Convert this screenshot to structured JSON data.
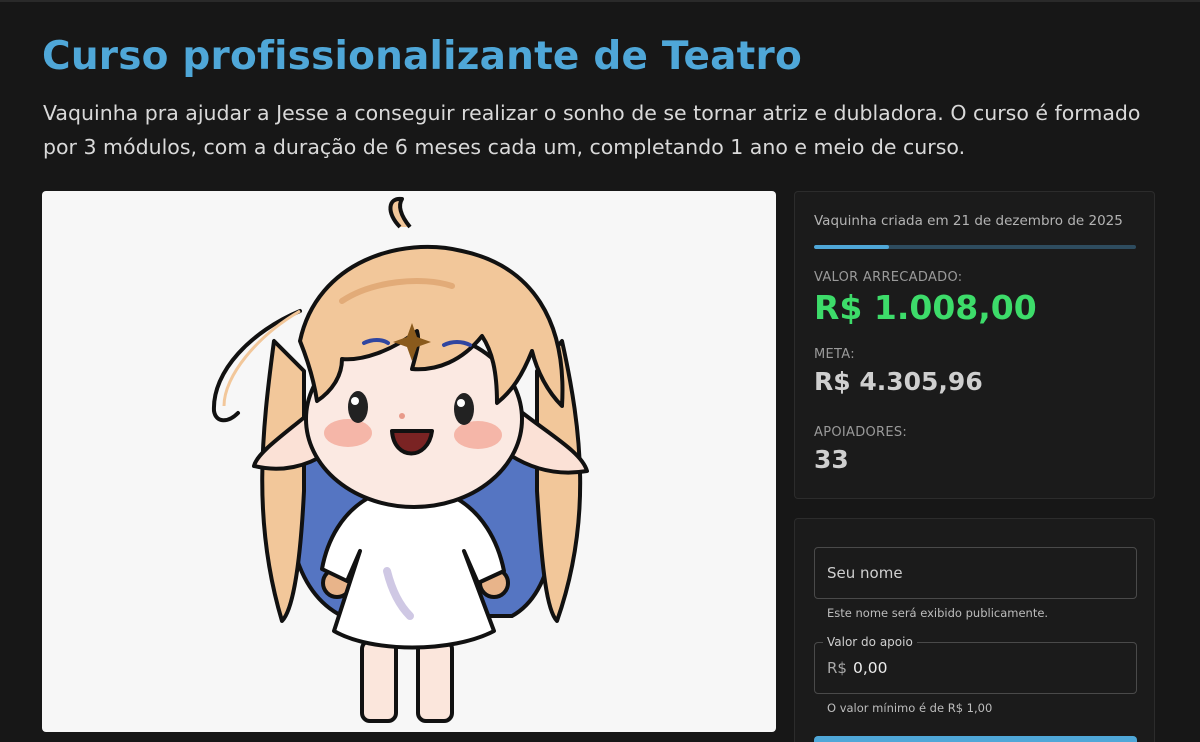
{
  "campaign": {
    "title": "Curso profissionalizante de Teatro",
    "description": "Vaquinha pra ajudar a Jesse a conseguir realizar o sonho de se tornar atriz e dubladora. O curso é formado por 3 módulos, com a duração de 6 meses cada um, completando 1 ano e meio de curso."
  },
  "stats": {
    "created_text": "Vaquinha criada em 21 de dezembro de 2025",
    "progress_fraction": 0.234,
    "raised_label": "VALOR ARRECADADO:",
    "raised_value": "R$ 1.008,00",
    "goal_label": "META:",
    "goal_value": "R$ 4.305,96",
    "backers_label": "APOIADORES:",
    "backers_value": "33"
  },
  "form": {
    "name_placeholder": "Seu nome",
    "name_helper": "Este nome será exibido publicamente.",
    "amount_label": "Valor do apoio",
    "currency_prefix": "R$",
    "amount_value": "0,00",
    "amount_helper": "O valor mínimo é de R$ 1,00"
  },
  "colors": {
    "accent": "#4fa7d8",
    "raised": "#3ddc6a",
    "background": "#171717"
  }
}
